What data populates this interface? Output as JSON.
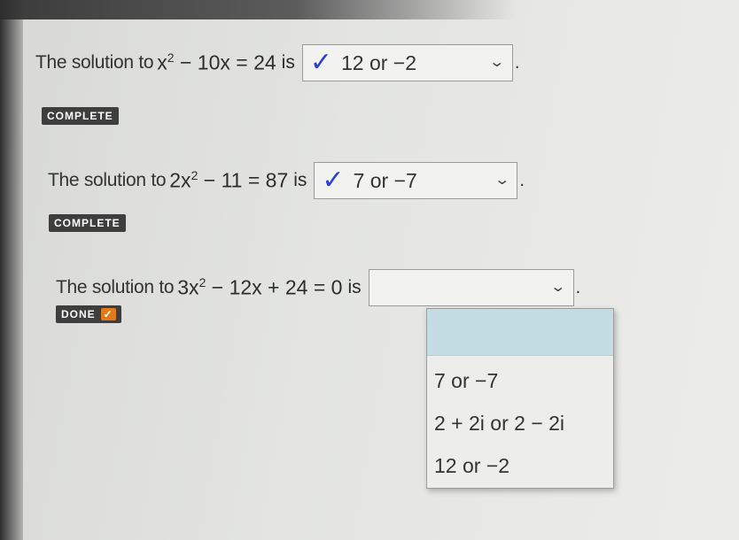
{
  "questions": [
    {
      "prefix": "The solution to",
      "equation": {
        "base": "x",
        "exp": "2",
        "rest": " − 10x = 24"
      },
      "suffix": "is",
      "answer": "12 or −2",
      "status": "COMPLETE"
    },
    {
      "prefix": "The solution to",
      "equation": {
        "base": "2x",
        "exp": "2",
        "rest": " − 11 = 87"
      },
      "suffix": "is",
      "answer": "7 or −7",
      "status": "COMPLETE"
    },
    {
      "prefix": "The solution to",
      "equation": {
        "base": "3x",
        "exp": "2",
        "rest": " − 12x + 24 = 0"
      },
      "suffix": "is",
      "answer": "",
      "status": "DONE"
    }
  ],
  "dropdown_options": [
    "7 or −7",
    "2 + 2i or 2 − 2i",
    "12 or −2"
  ],
  "icons": {
    "check": "check-icon",
    "chevron": "chevron-down-icon",
    "pointer": "mouse-pointer-icon"
  },
  "colors": {
    "check": "#2a3fd6",
    "badge": "#3e3e3e",
    "done_tick": "#e07a1a",
    "highlight": "#c4dde4"
  },
  "symbols": {
    "check": "✓",
    "chevron": "⌄",
    "period": "."
  }
}
